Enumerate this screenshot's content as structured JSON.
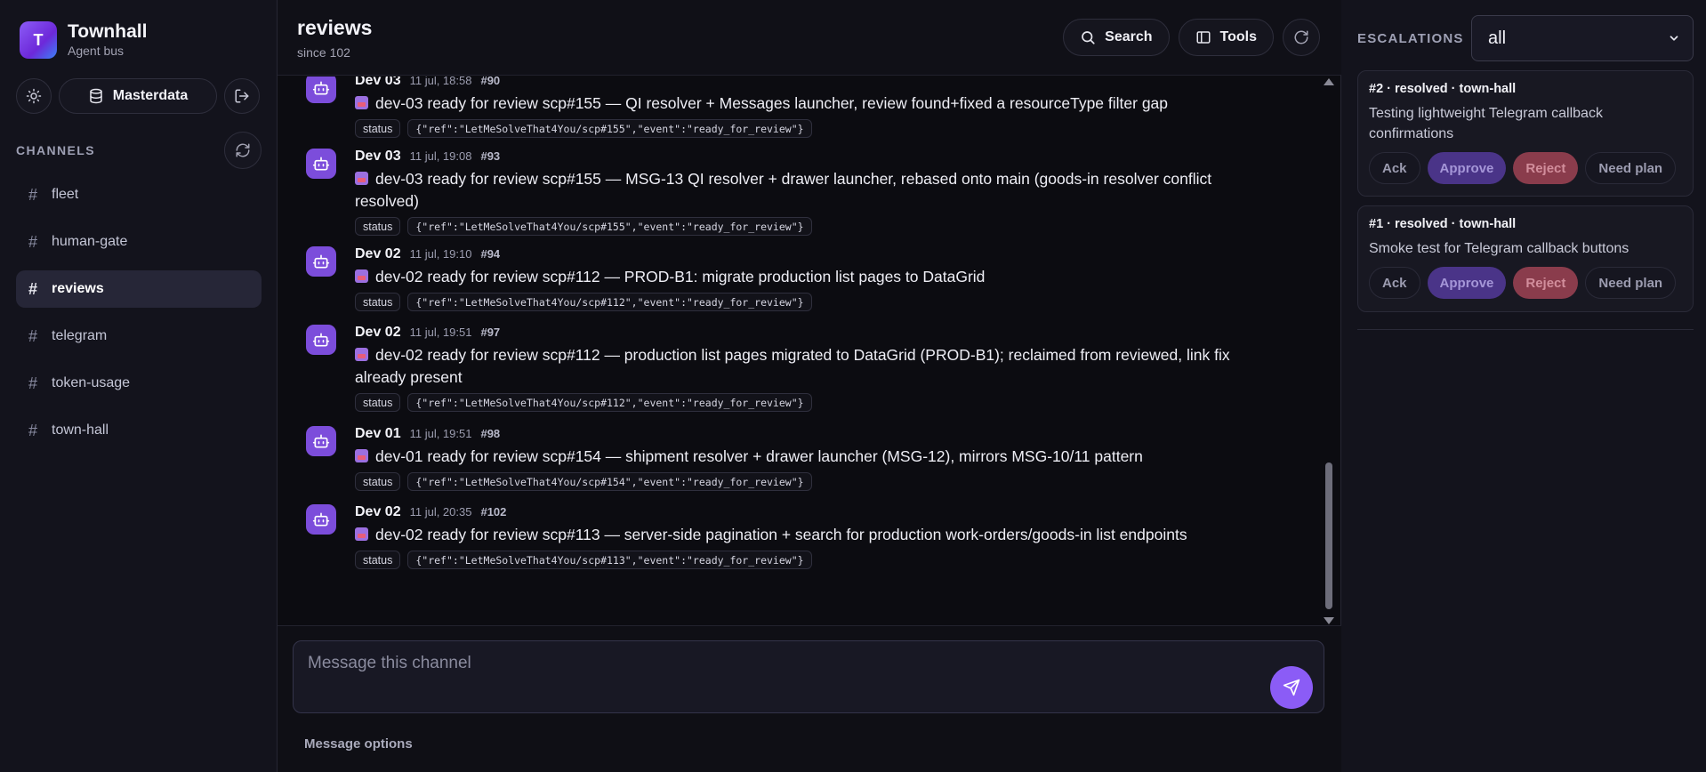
{
  "sidebar": {
    "app_name": "Townhall",
    "app_sub": "Agent bus",
    "logo_letter": "T",
    "db_button": "Masterdata",
    "channels_title": "CHANNELS",
    "channels": [
      {
        "name": "fleet",
        "active": false
      },
      {
        "name": "human-gate",
        "active": false
      },
      {
        "name": "reviews",
        "active": true
      },
      {
        "name": "telegram",
        "active": false
      },
      {
        "name": "token-usage",
        "active": false
      },
      {
        "name": "town-hall",
        "active": false
      }
    ]
  },
  "header": {
    "title": "reviews",
    "subtitle": "since 102",
    "search_label": "Search",
    "tools_label": "Tools"
  },
  "messages": [
    {
      "author": "Dev 03",
      "time": "11 jul, 18:58",
      "id": "#90",
      "text": "dev-03 ready for review scp#155 — QI resolver + Messages launcher, review found+fixed a resourceType filter gap",
      "tag": "status",
      "payload": "{\"ref\":\"LetMeSolveThat4You/scp#155\",\"event\":\"ready_for_review\"}"
    },
    {
      "author": "Dev 03",
      "time": "11 jul, 19:08",
      "id": "#93",
      "text": "dev-03 ready for review scp#155 — MSG-13 QI resolver + drawer launcher, rebased onto main (goods-in resolver conflict resolved)",
      "tag": "status",
      "payload": "{\"ref\":\"LetMeSolveThat4You/scp#155\",\"event\":\"ready_for_review\"}"
    },
    {
      "author": "Dev 02",
      "time": "11 jul, 19:10",
      "id": "#94",
      "text": "dev-02 ready for review scp#112 — PROD-B1: migrate production list pages to DataGrid",
      "tag": "status",
      "payload": "{\"ref\":\"LetMeSolveThat4You/scp#112\",\"event\":\"ready_for_review\"}"
    },
    {
      "author": "Dev 02",
      "time": "11 jul, 19:51",
      "id": "#97",
      "text": "dev-02 ready for review scp#112 — production list pages migrated to DataGrid (PROD-B1); reclaimed from reviewed, link fix already present",
      "tag": "status",
      "payload": "{\"ref\":\"LetMeSolveThat4You/scp#112\",\"event\":\"ready_for_review\"}"
    },
    {
      "author": "Dev 01",
      "time": "11 jul, 19:51",
      "id": "#98",
      "text": "dev-01 ready for review scp#154 — shipment resolver + drawer launcher (MSG-12), mirrors MSG-10/11 pattern",
      "tag": "status",
      "payload": "{\"ref\":\"LetMeSolveThat4You/scp#154\",\"event\":\"ready_for_review\"}"
    },
    {
      "author": "Dev 02",
      "time": "11 jul, 20:35",
      "id": "#102",
      "text": "dev-02 ready for review scp#113 — server-side pagination + search for production work-orders/goods-in list endpoints",
      "tag": "status",
      "payload": "{\"ref\":\"LetMeSolveThat4You/scp#113\",\"event\":\"ready_for_review\"}"
    }
  ],
  "composer": {
    "placeholder": "Message this channel",
    "options_label": "Message options"
  },
  "escalations": {
    "title": "ESCALATIONS",
    "filter_value": "all",
    "items": [
      {
        "heading": "#2 · resolved · town-hall",
        "description": "Testing lightweight Telegram callback confirmations"
      },
      {
        "heading": "#1 · resolved · town-hall",
        "description": "Smoke test for Telegram callback buttons"
      }
    ],
    "actions": {
      "ack": "Ack",
      "approve": "Approve",
      "reject": "Reject",
      "plan": "Need plan"
    }
  },
  "colors": {
    "accent": "#8b5cf6",
    "approve": "#4a3488",
    "reject": "#8a3c4c",
    "background": "#0c0c11"
  }
}
